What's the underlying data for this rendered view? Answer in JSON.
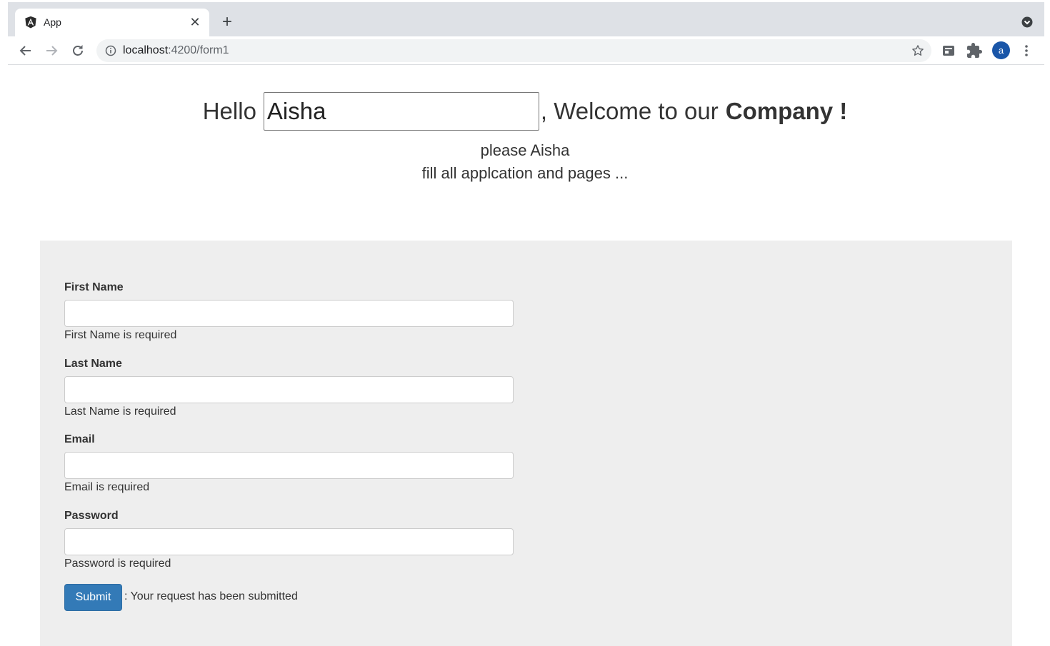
{
  "browser": {
    "tab_title": "App",
    "url_host": "localhost",
    "url_path": ":4200/form1",
    "profile_initial": "a",
    "icons": {
      "favicon": "angular-logo-icon",
      "close": "close-icon",
      "new_tab": "plus-icon",
      "tab_search": "chevron-down-icon",
      "back": "back-arrow-icon",
      "forward": "forward-arrow-icon",
      "reload": "reload-icon",
      "site_info": "info-icon",
      "bookmark": "star-icon",
      "extension_1": "cast-icon",
      "extensions": "puzzle-icon",
      "menu": "kebab-menu-icon"
    }
  },
  "header": {
    "hello": "Hello",
    "name_value": "Aisha",
    "welcome": ", Welcome to our",
    "company": "Company !",
    "line1": "please Aisha",
    "line2": "fill all applcation and pages ..."
  },
  "form": {
    "fields": [
      {
        "label": "First Name",
        "value": "",
        "error": "First Name is required"
      },
      {
        "label": "Last Name",
        "value": "",
        "error": "Last Name is required"
      },
      {
        "label": "Email",
        "value": "",
        "error": "Email is required"
      },
      {
        "label": "Password",
        "value": "",
        "error": "Password is required"
      }
    ],
    "submit_label": "Submit",
    "status": ": Your request has been submitted"
  },
  "colors": {
    "primary_button": "#337ab7",
    "panel_background": "#eeeeee",
    "avatar": "#1a56a8"
  }
}
